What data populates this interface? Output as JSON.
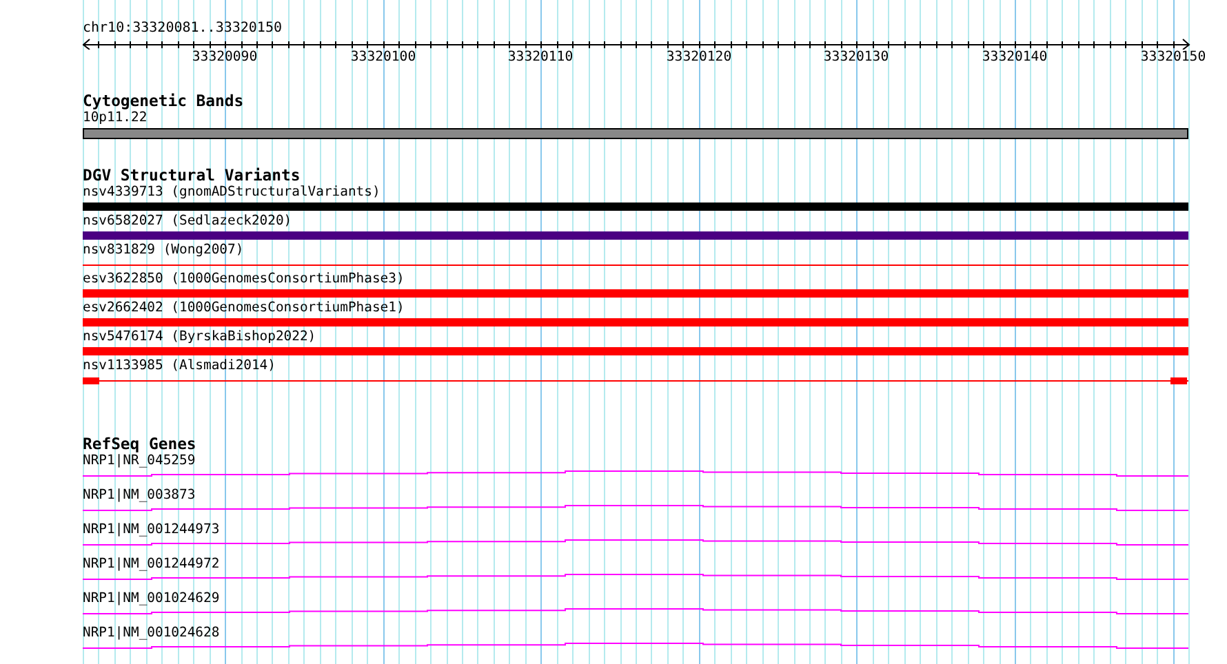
{
  "ruler": {
    "location": "chr10:33320081..33320150",
    "ticks": [
      "33320090",
      "33320100",
      "33320110",
      "33320120",
      "33320130",
      "33320140",
      "33320150"
    ]
  },
  "tracks": [
    {
      "title": "Cytogenetic Bands",
      "kind": "band",
      "features": [
        {
          "label": "10p11.22"
        }
      ]
    },
    {
      "title": "DGV Structural Variants",
      "kind": "variant",
      "features": [
        {
          "label": "nsv4339713 (gnomADStructuralVariants)",
          "kind": "thick",
          "color": "#000000"
        },
        {
          "label": "nsv6582027 (Sedlazeck2020)",
          "kind": "thick",
          "color": "#4b0082"
        },
        {
          "label": "nsv831829 (Wong2007)",
          "kind": "thin",
          "color": "#ff0000"
        },
        {
          "label": "esv3622850 (1000GenomesConsortiumPhase3)",
          "kind": "thick",
          "color": "#ff0000"
        },
        {
          "label": "esv2662402 (1000GenomesConsortiumPhase1)",
          "kind": "thick",
          "color": "#ff0000"
        },
        {
          "label": "nsv5476174 (ByrskaBishop2022)",
          "kind": "thick",
          "color": "#ff0000"
        },
        {
          "label": "nsv1133985 (Alsmadi2014)",
          "kind": "ends",
          "color": "#ff0000"
        }
      ]
    },
    {
      "title": "RefSeq Genes",
      "kind": "gene",
      "features": [
        {
          "label": "NRP1|NR_045259"
        },
        {
          "label": "NRP1|NM_003873"
        },
        {
          "label": "NRP1|NM_001244973"
        },
        {
          "label": "NRP1|NM_001244972"
        },
        {
          "label": "NRP1|NM_001024629"
        },
        {
          "label": "NRP1|NM_001024628"
        }
      ]
    }
  ]
}
